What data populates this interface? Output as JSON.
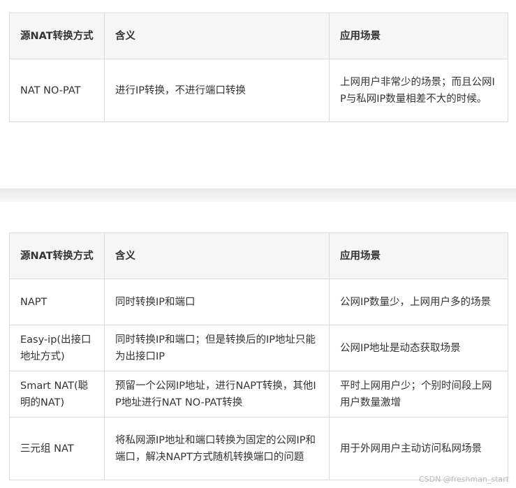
{
  "table1": {
    "headers": [
      "源NAT转换方式",
      "含义",
      "应用场景"
    ],
    "rows": [
      [
        "NAT NO-PAT",
        "进行IP转换，不进行端口转换",
        "上网用户非常少的场景；而且公网IP与私网IP数量相差不大的时候。"
      ]
    ]
  },
  "table2": {
    "headers": [
      "源NAT转换方式",
      "含义",
      "应用场景"
    ],
    "rows": [
      [
        "NAPT",
        "同时转换IP和端口",
        "公网IP数量少，上网用户多的场景"
      ],
      [
        "Easy-ip(出接口地址方式)",
        "同时转换IP和端口；但是转换后的IP地址只能为出接口IP",
        "公网IP地址是动态获取场景"
      ],
      [
        "Smart NAT(聪明的NAT)",
        "预留一个公网IP地址，进行NAPT转换，其他IP地址进行NAT NO-PAT转换",
        "平时上网用户少；个别时间段上网用户数量激增"
      ],
      [
        "三元组 NAT",
        "将私网源IP地址和端口转换为固定的公网IP和端口，解决NAPT方式随机转换端口的问题",
        "用于外网用户主动访问私网场景"
      ]
    ]
  },
  "watermark": "CSDN @freshman_start"
}
